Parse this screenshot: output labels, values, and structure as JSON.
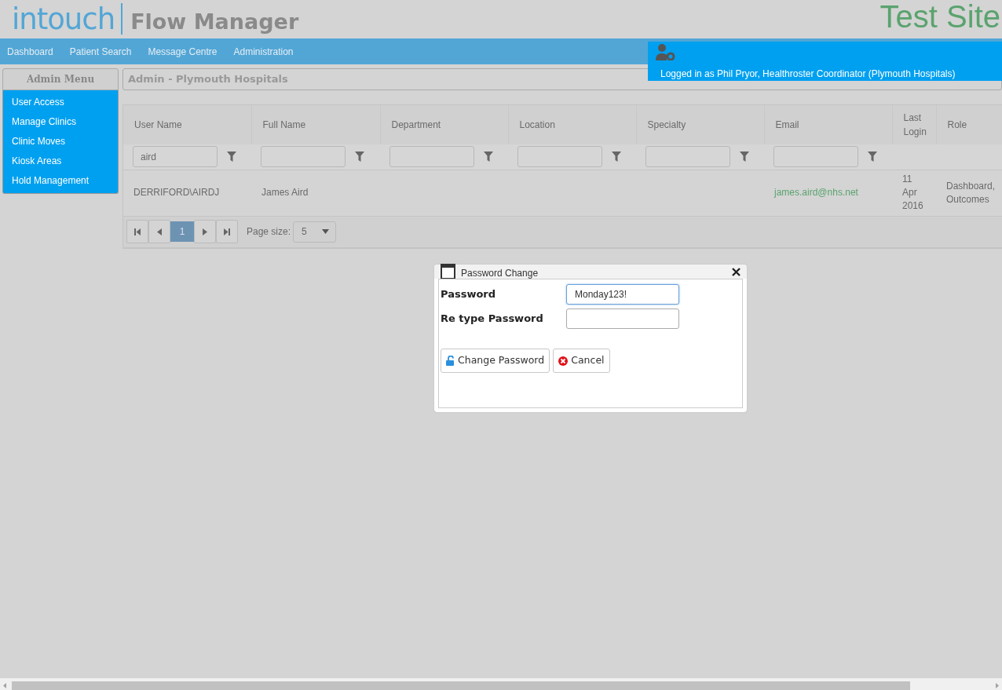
{
  "header": {
    "logo": "intouch",
    "product": "Flow Manager",
    "site": "Test Site"
  },
  "nav": [
    {
      "label": "Dashboard"
    },
    {
      "label": "Patient Search"
    },
    {
      "label": "Message Centre"
    },
    {
      "label": "Administration"
    }
  ],
  "user_panel": {
    "text": "Logged in as Phil Pryor, Healthroster Coordinator (Plymouth Hospitals)"
  },
  "sidebar": {
    "title": "Admin Menu",
    "items": [
      {
        "label": "User Access"
      },
      {
        "label": "Manage Clinics"
      },
      {
        "label": "Clinic Moves"
      },
      {
        "label": "Kiosk Areas"
      },
      {
        "label": "Hold Management"
      }
    ]
  },
  "main": {
    "title": "Admin - Plymouth Hospitals"
  },
  "table": {
    "columns": [
      {
        "label": "User Name",
        "filter": true,
        "filter_value": "aird"
      },
      {
        "label": "Full Name",
        "filter": true
      },
      {
        "label": "Department",
        "filter": true
      },
      {
        "label": "Location",
        "filter": true
      },
      {
        "label": "Specialty",
        "filter": true
      },
      {
        "label": "Email",
        "filter": true
      },
      {
        "label": "Last Login",
        "filter": false
      },
      {
        "label": "Role",
        "filter": false
      }
    ],
    "rows": [
      [
        {
          "text": "DERRIFORD\\AIRDJ",
          "kind": "text"
        },
        {
          "text": "James Aird",
          "kind": "text"
        },
        null,
        null,
        null,
        {
          "text": "james.aird@nhs.net",
          "kind": "link"
        },
        {
          "text": "11 Apr 2016",
          "kind": "text"
        },
        {
          "text": "Dashboard, Outcomes",
          "kind": "text"
        }
      ]
    ]
  },
  "pager": {
    "pages": [
      {
        "label": "1",
        "selected": true
      }
    ],
    "page_size_label": "Page size:",
    "page_size": "5"
  },
  "dialog": {
    "title": "Password Change",
    "fields": [
      {
        "label": "Password",
        "value": "Monday123!",
        "focused": true
      },
      {
        "label": "Re type Password",
        "focused": false
      }
    ],
    "buttons": [
      {
        "label": "Change Password",
        "kind": "confirm"
      },
      {
        "label": "Cancel",
        "kind": "cancel"
      }
    ]
  }
}
